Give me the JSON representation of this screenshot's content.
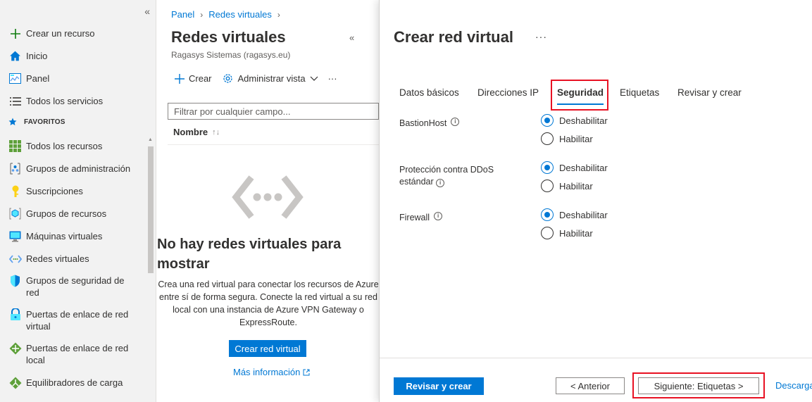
{
  "leftnav": {
    "create": "Crear un recurso",
    "items_top": [
      {
        "label": "Inicio",
        "icon": "home-icon"
      },
      {
        "label": "Panel",
        "icon": "dashboard-icon"
      },
      {
        "label": "Todos los servicios",
        "icon": "list-icon"
      }
    ],
    "favorites_header": "FAVORITOS",
    "favorites": [
      {
        "label": "Todos los recursos",
        "icon": "grid-icon"
      },
      {
        "label": "Grupos de administración",
        "icon": "management-group-icon"
      },
      {
        "label": "Suscripciones",
        "icon": "key-icon"
      },
      {
        "label": "Grupos de recursos",
        "icon": "resource-group-icon"
      },
      {
        "label": "Máquinas virtuales",
        "icon": "vm-icon"
      },
      {
        "label": "Redes virtuales",
        "icon": "vnet-icon"
      },
      {
        "label": "Grupos de seguridad de red",
        "icon": "shield-icon"
      },
      {
        "label": "Puertas de enlace de red virtual",
        "icon": "vpn-gateway-icon"
      },
      {
        "label": "Puertas de enlace de red local",
        "icon": "local-gateway-icon"
      },
      {
        "label": "Equilibradores de carga",
        "icon": "load-balancer-icon"
      }
    ]
  },
  "mid": {
    "breadcrumb": [
      "Panel",
      "Redes virtuales"
    ],
    "title": "Redes virtuales",
    "subtitle": "Ragasys Sistemas (ragasys.eu)",
    "toolbar": {
      "create": "Crear",
      "manage_view": "Administrar vista",
      "more": "···"
    },
    "filter_placeholder": "Filtrar por cualquier campo...",
    "column_name": "Nombre",
    "empty_title": "No hay redes virtuales para mostrar",
    "empty_desc": "Crea una red virtual para conectar los recursos de Azure entre sí de forma segura. Conecte la red virtual a su red local con una instancia de Azure VPN Gateway o ExpressRoute.",
    "create_button": "Crear red virtual",
    "more_info": "Más información"
  },
  "blade": {
    "title": "Crear red virtual",
    "more": "···",
    "tabs": [
      "Datos básicos",
      "Direcciones IP",
      "Seguridad",
      "Etiquetas",
      "Revisar y crear"
    ],
    "active_tab": "Seguridad",
    "fields": [
      {
        "label": "BastionHost",
        "options": [
          "Deshabilitar",
          "Habilitar"
        ],
        "selected": "Deshabilitar"
      },
      {
        "label": "Protección contra DDoS estándar",
        "options": [
          "Deshabilitar",
          "Habilitar"
        ],
        "selected": "Deshabilitar"
      },
      {
        "label": "Firewall",
        "options": [
          "Deshabilitar",
          "Habilitar"
        ],
        "selected": "Deshabilitar"
      }
    ],
    "footer": {
      "review_create": "Revisar y crear",
      "previous": "< Anterior",
      "next": "Siguiente: Etiquetas >",
      "download": "Descargar"
    }
  },
  "colors": {
    "accent": "#0078d4",
    "highlight": "#e81123"
  }
}
